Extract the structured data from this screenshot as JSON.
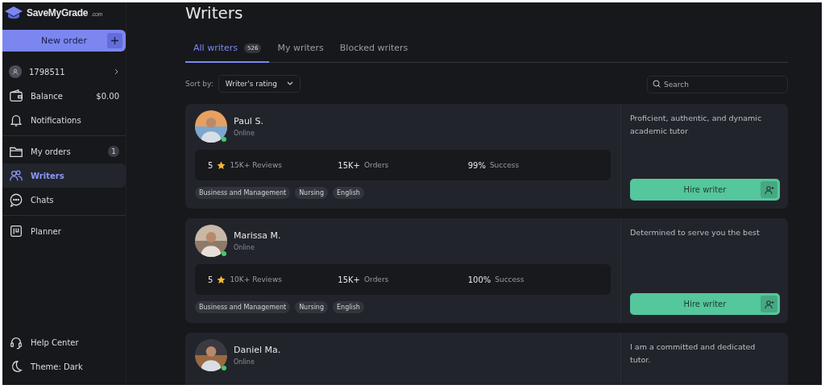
{
  "brand": {
    "name": "SaveMyGrade",
    "suffix": ".com"
  },
  "sidebar": {
    "new_order": "New order",
    "account": "1798511",
    "balance": {
      "label": "Balance",
      "value": "$0.00"
    },
    "items": [
      {
        "kind": "notifications",
        "label": "Notifications",
        "selected": false
      },
      {
        "kind": "divider"
      },
      {
        "kind": "orders",
        "label": "My orders",
        "badge": "1",
        "selected": false
      },
      {
        "kind": "writers",
        "label": "Writers",
        "selected": true
      },
      {
        "kind": "chats",
        "label": "Chats",
        "selected": false
      },
      {
        "kind": "divider"
      },
      {
        "kind": "planner",
        "label": "Planner",
        "selected": false
      }
    ],
    "footer": [
      {
        "kind": "help",
        "label": "Help Center"
      },
      {
        "kind": "theme",
        "label": "Theme: Dark"
      }
    ]
  },
  "page": {
    "title": "Writers",
    "tabs": [
      {
        "label": "All writers",
        "count": "526",
        "selected": true
      },
      {
        "label": "My writers",
        "selected": false
      },
      {
        "label": "Blocked writers",
        "selected": false
      }
    ],
    "sort": {
      "label": "Sort by:",
      "value": "Writer's rating"
    },
    "search": {
      "placeholder": "Search"
    },
    "writers": [
      {
        "name": "Paul S.",
        "status": "Online",
        "rating": "5",
        "reviews": "15K+ Reviews",
        "orders": "15K+",
        "orders_label": "Orders",
        "success": "99%",
        "success_label": "Success",
        "tags": [
          "Business and Management",
          "Nursing",
          "English"
        ],
        "bio": "Proficient, authentic, and dynamic academic tutor",
        "hire": "Hire writer"
      },
      {
        "name": "Marissa M.",
        "status": "Online",
        "rating": "5",
        "reviews": "10K+ Reviews",
        "orders": "15K+",
        "orders_label": "Orders",
        "success": "100%",
        "success_label": "Success",
        "tags": [
          "Business and Management",
          "Nursing",
          "English"
        ],
        "bio": "Determined to serve you the best",
        "hire": "Hire writer"
      },
      {
        "name": "Daniel Ma.",
        "status": "Online",
        "bio": "I am a committed and dedicated tutor."
      }
    ]
  }
}
